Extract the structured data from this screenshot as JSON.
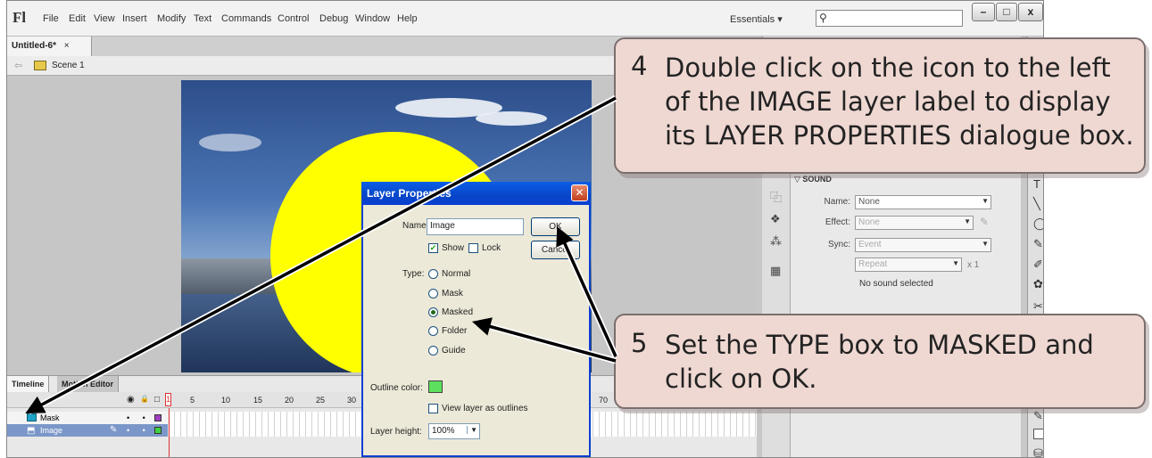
{
  "app": {
    "logo": "Fl",
    "menu": [
      "File",
      "Edit",
      "View",
      "Insert",
      "Modify",
      "Text",
      "Commands",
      "Control",
      "Debug",
      "Window",
      "Help"
    ],
    "workspace": "Essentials",
    "workspace_arrow": "▾",
    "search_glyph": "⚲",
    "window_buttons": {
      "minimize": "–",
      "maximize": "□",
      "close": "x"
    }
  },
  "document": {
    "tab_title": "Untitled-6*",
    "tab_close": "×",
    "scene_back": "⇦",
    "scene_label": "Scene 1"
  },
  "timeline": {
    "tabs": [
      "Timeline",
      "Motion Editor"
    ],
    "header_icons": {
      "eye": "◉",
      "lock": "🔒",
      "outline": "□"
    },
    "frame_numbers": [
      "5",
      "10",
      "15",
      "20",
      "25",
      "30",
      "70"
    ],
    "playhead": "1",
    "layers": [
      {
        "name": "Mask",
        "dots": "• •",
        "color": "#a040c0"
      },
      {
        "name": "Image",
        "dots": "• •",
        "color": "#40d040"
      }
    ]
  },
  "properties": {
    "section": "SOUND",
    "name_label": "Name:",
    "name_value": "None",
    "effect_label": "Effect:",
    "effect_value": "None",
    "sync_label": "Sync:",
    "sync_value": "Event",
    "repeat_value": "Repeat",
    "repeat_count": "x 1",
    "no_sound": "No sound selected"
  },
  "dialog": {
    "title": "Layer Properties",
    "close_glyph": "✕",
    "name_label": "Name:",
    "name_value": "Image",
    "ok": "OK",
    "cancel": "Cancel",
    "show_label": "Show",
    "lock_label": "Lock",
    "type_label": "Type:",
    "types": [
      {
        "label": "Normal",
        "selected": false
      },
      {
        "label": "Mask",
        "selected": false
      },
      {
        "label": "Masked",
        "selected": true
      },
      {
        "label": "Folder",
        "selected": false
      },
      {
        "label": "Guide",
        "selected": false
      }
    ],
    "outline_color_label": "Outline color:",
    "outline_color": "#5de05d",
    "view_outlines_label": "View layer as outlines",
    "layer_height_label": "Layer height:",
    "layer_height_value": "100%"
  },
  "callouts": [
    {
      "number": "4",
      "lines": [
        "Double click on the icon to the left",
        "of the IMAGE layer label to display",
        "its LAYER PROPERTIES dialogue box."
      ]
    },
    {
      "number": "5",
      "lines": [
        "Set the TYPE box to MASKED and",
        "click on OK."
      ]
    }
  ]
}
